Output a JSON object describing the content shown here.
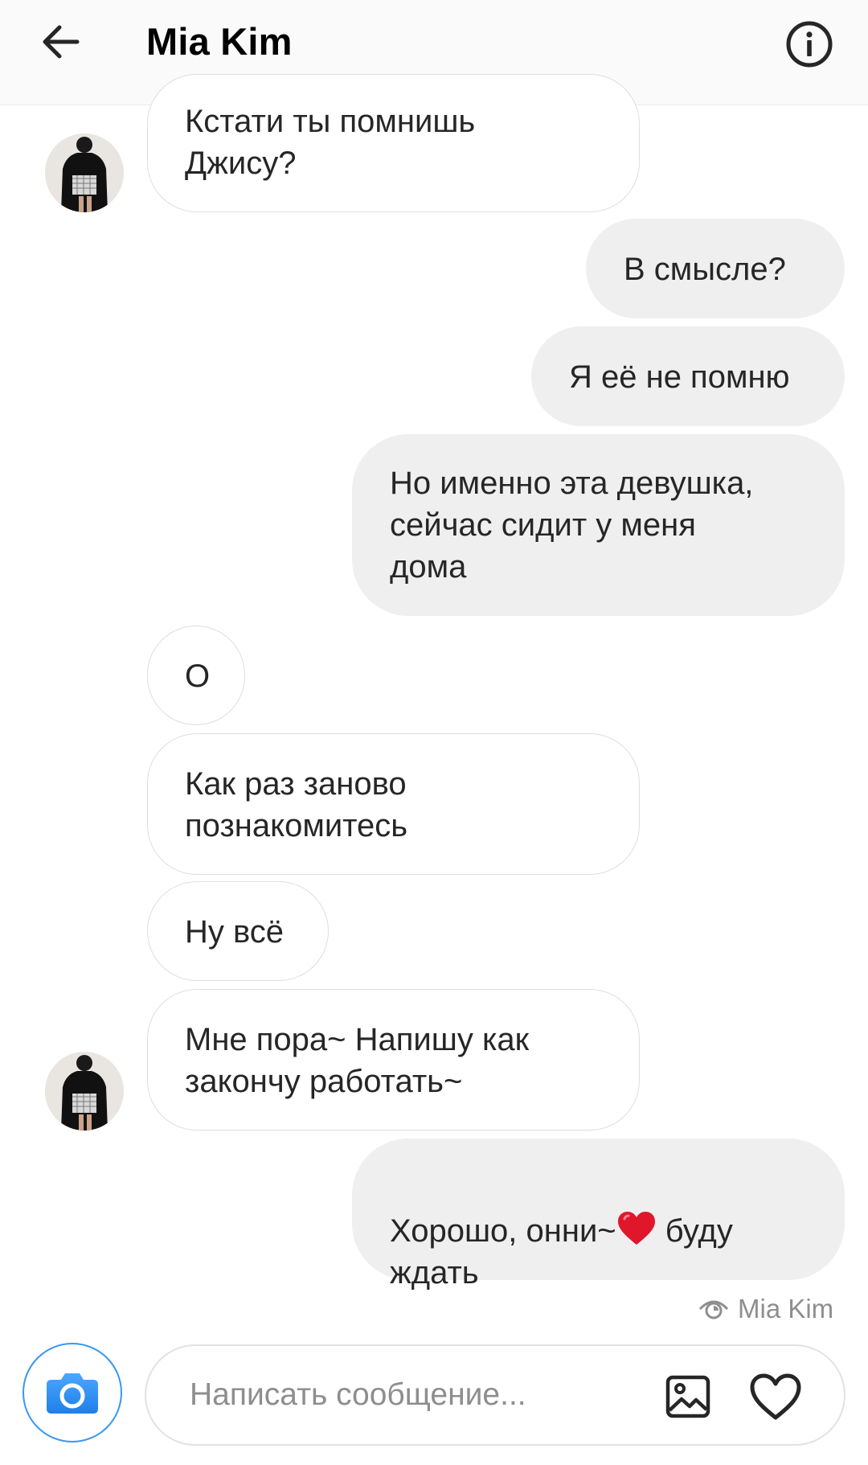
{
  "header": {
    "title": "Mia Kim",
    "back_icon": "arrow-left-icon",
    "info_icon": "info-circle-icon"
  },
  "messages": [
    {
      "direction": "incoming",
      "text": "Кстати ты помнишь\nДжису?"
    },
    {
      "direction": "outgoing",
      "text": "В смысле?"
    },
    {
      "direction": "outgoing",
      "text": "Я её не помню"
    },
    {
      "direction": "outgoing",
      "text": "Но именно эта девушка,\nсейчас сидит у меня\nдома"
    },
    {
      "direction": "incoming",
      "text": "О"
    },
    {
      "direction": "incoming",
      "text": "Как раз заново\nпознакомитесь"
    },
    {
      "direction": "incoming",
      "text": "Ну всё"
    },
    {
      "direction": "incoming",
      "text": "Мне пора~ Напишу как\nзакончу работать~"
    },
    {
      "direction": "outgoing",
      "text_before_emoji": "Хорошо,  онни~",
      "emoji": "heart",
      "text_after_emoji": " буду\nждать"
    }
  ],
  "seen": {
    "icon": "eye-icon",
    "label": "Mia Kim"
  },
  "composer": {
    "placeholder": "Написать сообщение...",
    "camera_icon": "camera-icon",
    "gallery_icon": "image-icon",
    "like_icon": "heart-icon"
  },
  "colors": {
    "accent": "#3897f0",
    "outgoing_bubble": "#efefef",
    "incoming_border": "#dedede",
    "heart_emoji": "#e0162b"
  }
}
